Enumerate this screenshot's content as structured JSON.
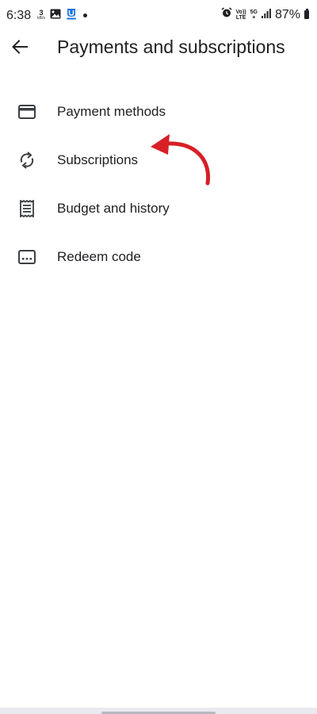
{
  "status_bar": {
    "time": "6:38",
    "net_speed_value": "3",
    "net_speed_unit": "kB/s",
    "volte_label_top": "Vo))",
    "volte_label_bottom": "LTE",
    "network_type_top": "5G",
    "network_type_bottom": "+",
    "battery_percent": "87%"
  },
  "app_bar": {
    "title": "Payments and subscriptions"
  },
  "menu": {
    "items": [
      {
        "label": "Payment methods",
        "icon": "credit-card-icon"
      },
      {
        "label": "Subscriptions",
        "icon": "sync-icon"
      },
      {
        "label": "Budget and history",
        "icon": "receipt-icon"
      },
      {
        "label": "Redeem code",
        "icon": "redeem-code-icon"
      }
    ]
  },
  "colors": {
    "annotation_arrow": "#d81f26",
    "text": "#202124",
    "icon": "#3c4043",
    "nav_bar": "#e9e9f0"
  }
}
